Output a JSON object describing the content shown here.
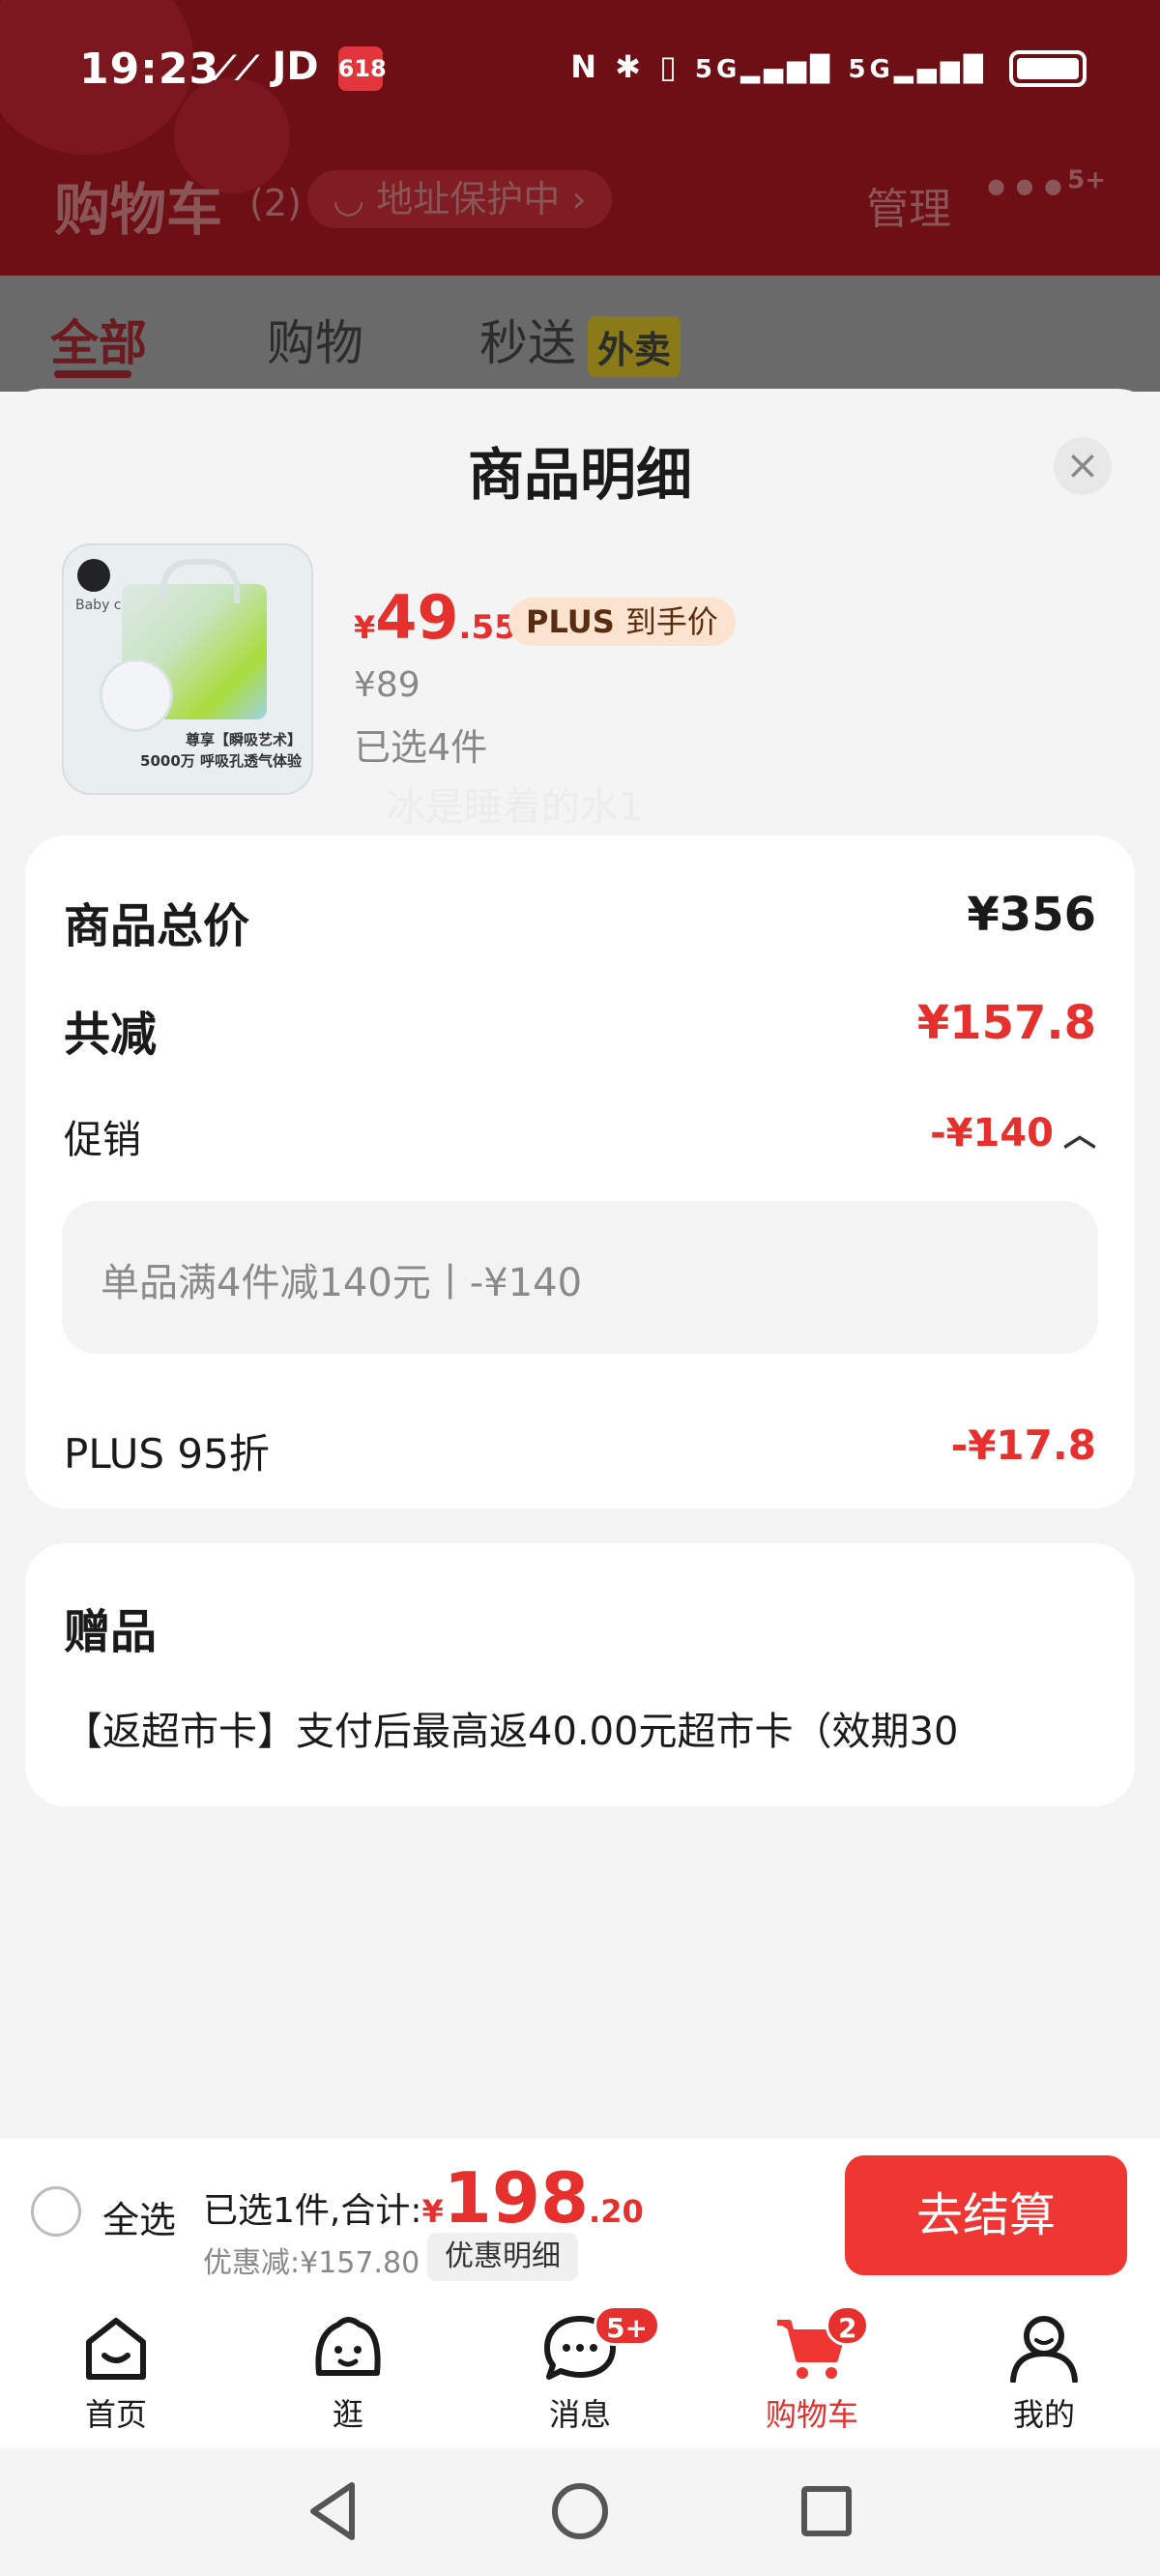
{
  "status_bar": {
    "time": "19:23",
    "left_icons": "JD",
    "badge": "618"
  },
  "background": {
    "title": "购物车",
    "count": "(2)",
    "address": "地址保护中",
    "manage": "管理",
    "more_badge": "5+",
    "tabs": [
      {
        "label": "全部"
      },
      {
        "label": "购物"
      },
      {
        "label": "秒送"
      }
    ],
    "tab_badge": "外卖"
  },
  "sheet": {
    "title": "商品明细",
    "product": {
      "brand": "Baby care",
      "caption1": "尊享【瞬吸艺术】",
      "caption2": "5000万 呼吸孔透气体验",
      "price_symbol": "¥",
      "price_int": "49",
      "price_dec": ".55",
      "plus_tag_strong": "PLUS",
      "plus_tag_text": "到手价",
      "original_price": "¥89",
      "selected_qty": "已选4件"
    },
    "price_card": {
      "total_label": "商品总价",
      "total_value": "¥356",
      "reduce_label": "共减",
      "reduce_value": "¥157.8",
      "promo_label": "促销",
      "promo_value": "-¥140",
      "promo_detail": "单品满4件减140元丨-¥140",
      "watermark": "冰是睡着的水1",
      "plus_label": "PLUS 95折",
      "plus_value": "-¥17.8"
    },
    "gift_card": {
      "title": "赠品",
      "text": "【返超市卡】支付后最高返40.00元超市卡（效期30"
    }
  },
  "checkout": {
    "select_all": "全选",
    "summary_label": "已选1件,合计:",
    "price_symbol": "¥",
    "price_int": "198",
    "price_dec": ".20",
    "saved": "优惠减:¥157.80",
    "discount_button": "优惠明细",
    "checkout_button": "去结算"
  },
  "tabbar": {
    "items": [
      {
        "label": "首页",
        "icon": "home-icon"
      },
      {
        "label": "逛",
        "icon": "browse-icon"
      },
      {
        "label": "消息",
        "icon": "message-icon",
        "badge": "5+"
      },
      {
        "label": "购物车",
        "icon": "cart-icon",
        "badge": "2"
      },
      {
        "label": "我的",
        "icon": "profile-icon"
      }
    ]
  },
  "colors": {
    "accent": "#e6302d",
    "header_dim": "#6e0f16"
  }
}
